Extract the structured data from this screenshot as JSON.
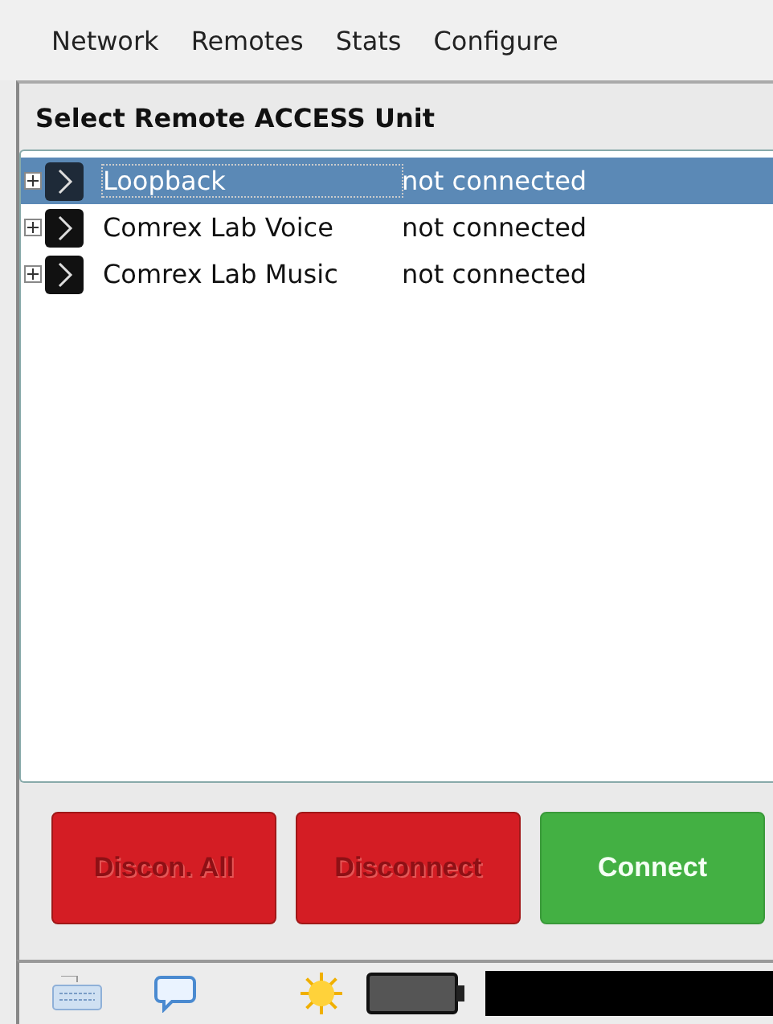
{
  "menu": [
    "Network",
    "Remotes",
    "Stats",
    "Configure"
  ],
  "panel": {
    "title": "Select Remote ACCESS Unit"
  },
  "units": [
    {
      "name": "Loopback",
      "status": "not connected",
      "selected": true,
      "expanded": false
    },
    {
      "name": "Comrex Lab Voice",
      "status": "not connected",
      "selected": false,
      "expanded": false
    },
    {
      "name": "Comrex Lab Music",
      "status": "not connected",
      "selected": false,
      "expanded": false
    }
  ],
  "buttons": [
    {
      "label": "Discon. All",
      "kind": "danger",
      "disabled": true
    },
    {
      "label": "Disconnect",
      "kind": "danger",
      "disabled": true
    },
    {
      "label": "Connect",
      "kind": "go",
      "disabled": false
    }
  ]
}
